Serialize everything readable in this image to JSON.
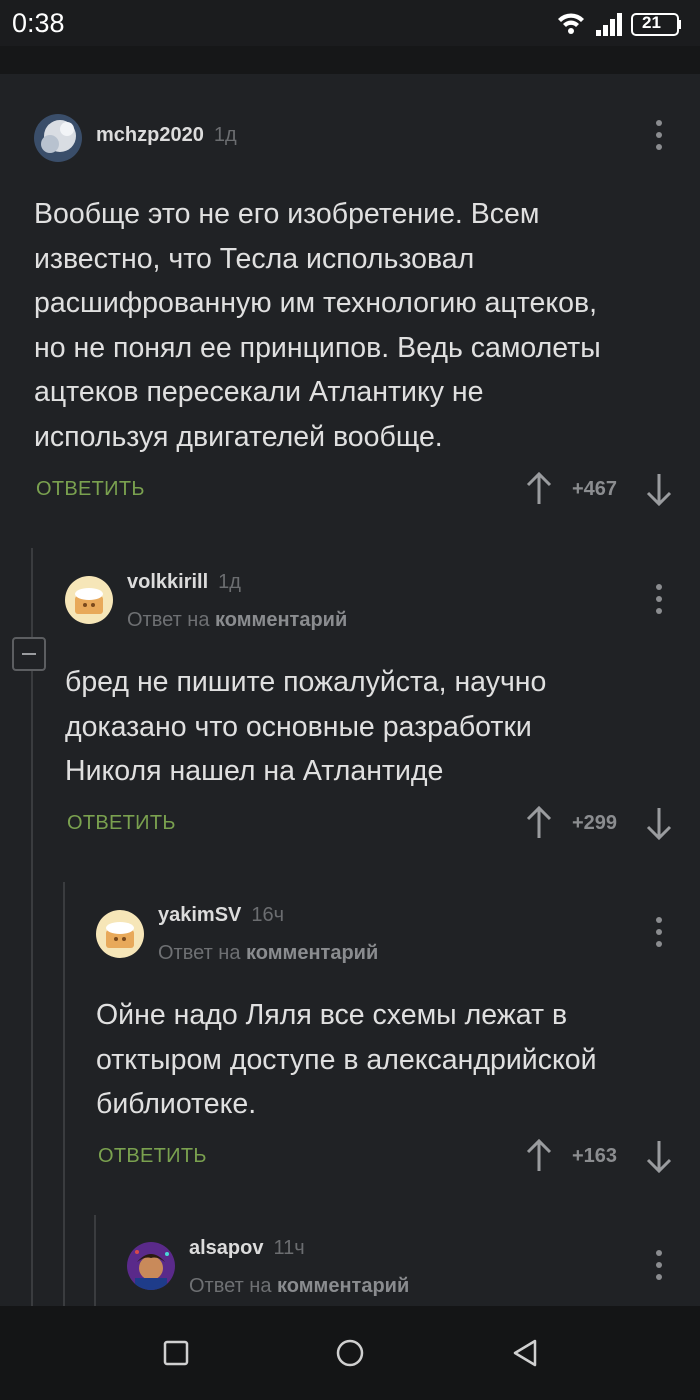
{
  "status_bar": {
    "time": "0:38",
    "battery": "21"
  },
  "reply_label": "ОТВЕТИТЬ",
  "reply_to": {
    "prefix": "Ответ на",
    "link": "комментарий"
  },
  "comments": [
    {
      "username": "mchzp2020",
      "time_ago": "1д",
      "lines": [
        "Вообще это не его изобретение. Всем",
        "известно, что Тесла использовал",
        "расшифрованную им технологию ацтеков,",
        "но не понял ее принципов. Ведь самолеты",
        "ацтеков пересекали Атлантику не",
        "используя двигателей вообще."
      ],
      "score": "+467"
    },
    {
      "username": "volkkirill",
      "time_ago": "1д",
      "lines": [
        "бред не пишите пожалуйста, научно",
        "доказано что основные разработки",
        "Николя нашел на Атлантиде"
      ],
      "score": "+299"
    },
    {
      "username": "yakimSV",
      "time_ago": "16ч",
      "lines": [
        "Ойне надо Ляля все схемы лежат в",
        "отктыром доступе в александрийской",
        "библиотеке."
      ],
      "score": "+163"
    },
    {
      "username": "alsapov",
      "time_ago": "11ч"
    }
  ],
  "colors": {
    "background": "#202225",
    "reply_green": "#7aa14f",
    "muted": "#6e7073"
  }
}
